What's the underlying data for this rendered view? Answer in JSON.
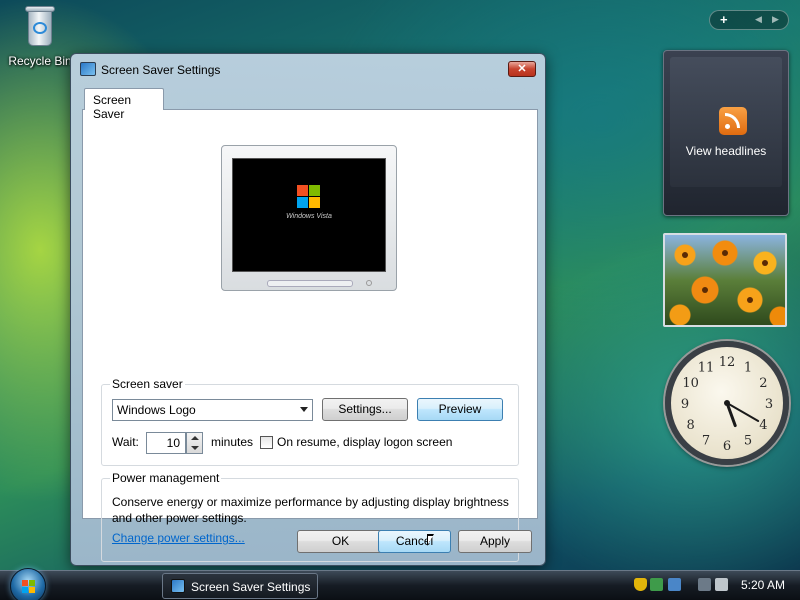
{
  "desktop": {
    "recycle_bin_label": "Recycle Bin"
  },
  "dialog": {
    "title": "Screen Saver Settings",
    "close_glyph": "✕",
    "tab_label": "Screen Saver",
    "preview_logo_text": "Windows Vista",
    "screen_saver_group": {
      "label": "Screen saver",
      "selected": "Windows Logo",
      "settings_button": "Settings...",
      "preview_button": "Preview",
      "wait_label": "Wait:",
      "wait_value": "10",
      "minutes_label": "minutes",
      "logon_checkbox_label": "On resume, display logon screen",
      "logon_checked": false
    },
    "power_group": {
      "label": "Power management",
      "description": "Conserve energy or maximize performance by adjusting display brightness and other power settings.",
      "link": "Change power settings..."
    },
    "buttons": {
      "ok": "OK",
      "cancel": "Cancel",
      "apply": "Apply"
    }
  },
  "sidebar": {
    "controls": {
      "add": "+",
      "prev": "◀",
      "next": "▶"
    },
    "feed_gadget_label": "View headlines",
    "clock_time": {
      "hour": 5,
      "minute": 20
    },
    "clock_numerals": [
      "12",
      "1",
      "2",
      "3",
      "4",
      "5",
      "6",
      "7",
      "8",
      "9",
      "10",
      "11"
    ]
  },
  "taskbar": {
    "task_label": "Screen Saver Settings",
    "time": "5:20 AM"
  },
  "colors": {
    "link": "#0066cc",
    "close_button": "#c7432e",
    "focus_button": "#3c7fb1"
  }
}
